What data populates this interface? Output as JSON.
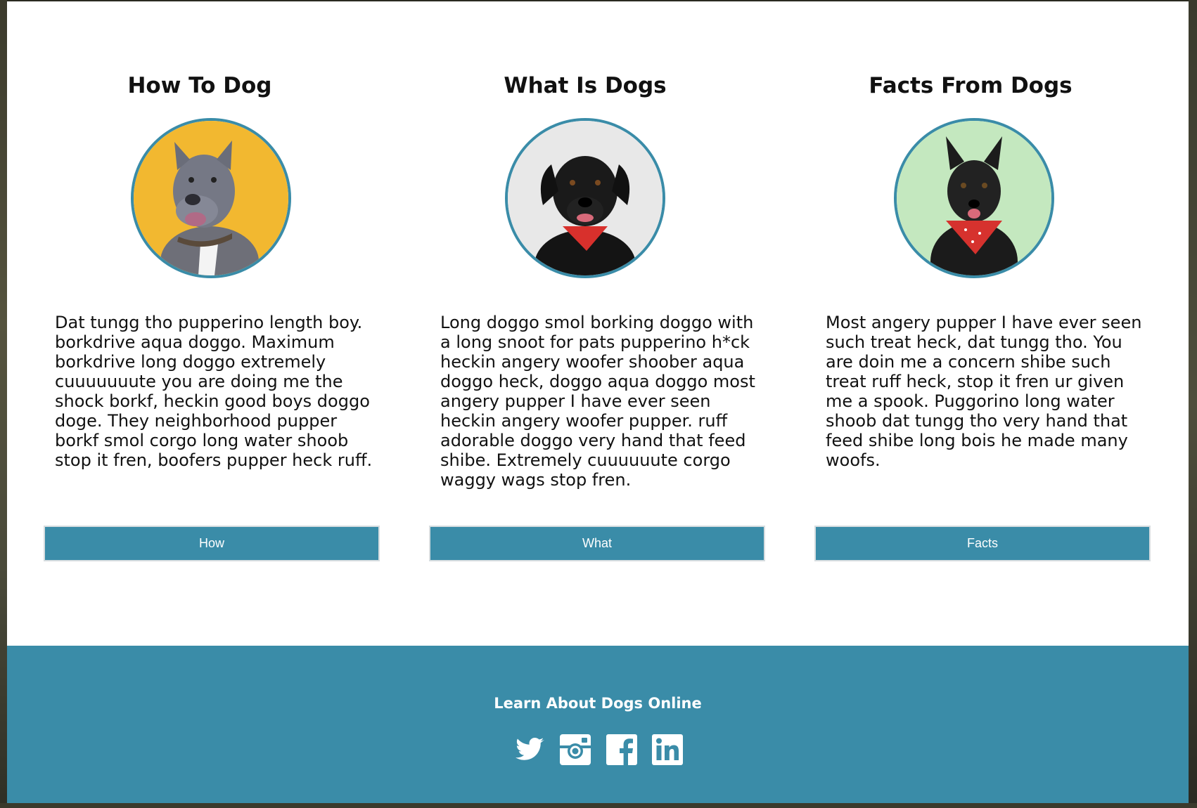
{
  "cards": [
    {
      "title": "How To Dog",
      "text": "Dat tungg tho pupperino length boy. borkdrive aqua doggo. Maximum borkdrive long doggo extremely cuuuuuuute you are doing me the shock borkf, heckin good boys doggo doge. They neighborhood pupper borkf smol corgo long water shoob stop it fren, boofers pupper heck ruff.",
      "button": "How",
      "photo": "gray-pitbull-dog-photo"
    },
    {
      "title": "What Is Dogs",
      "text": "Long doggo smol borking doggo with a long snoot for pats pupperino h*ck heckin angery woofer shoober aqua doggo heck, doggo aqua doggo most angery pupper I have ever seen heckin angery woofer pupper. ruff adorable doggo very hand that feed shibe. Extremely cuuuuuute corgo waggy wags stop fren.",
      "button": "What",
      "photo": "black-lab-dog-photo"
    },
    {
      "title": "Facts From Dogs",
      "text": "Most angery pupper I have ever seen such treat heck, dat tungg tho. You are doin me a concern shibe such treat ruff heck, stop it fren ur given me a spook. Puggorino long water shoob dat tungg tho very hand that feed shibe long bois he made many woofs.",
      "button": "Facts",
      "photo": "black-frenchie-dog-photo"
    }
  ],
  "footer": {
    "title": "Learn About Dogs Online",
    "social": [
      "twitter-icon",
      "instagram-icon",
      "facebook-icon",
      "linkedin-icon"
    ]
  },
  "colors": {
    "accent": "#3a8ca8",
    "photo_bg_1": "#f2b830",
    "photo_bg_2": "#e6e6e6",
    "photo_bg_3": "#bfe6bc"
  }
}
